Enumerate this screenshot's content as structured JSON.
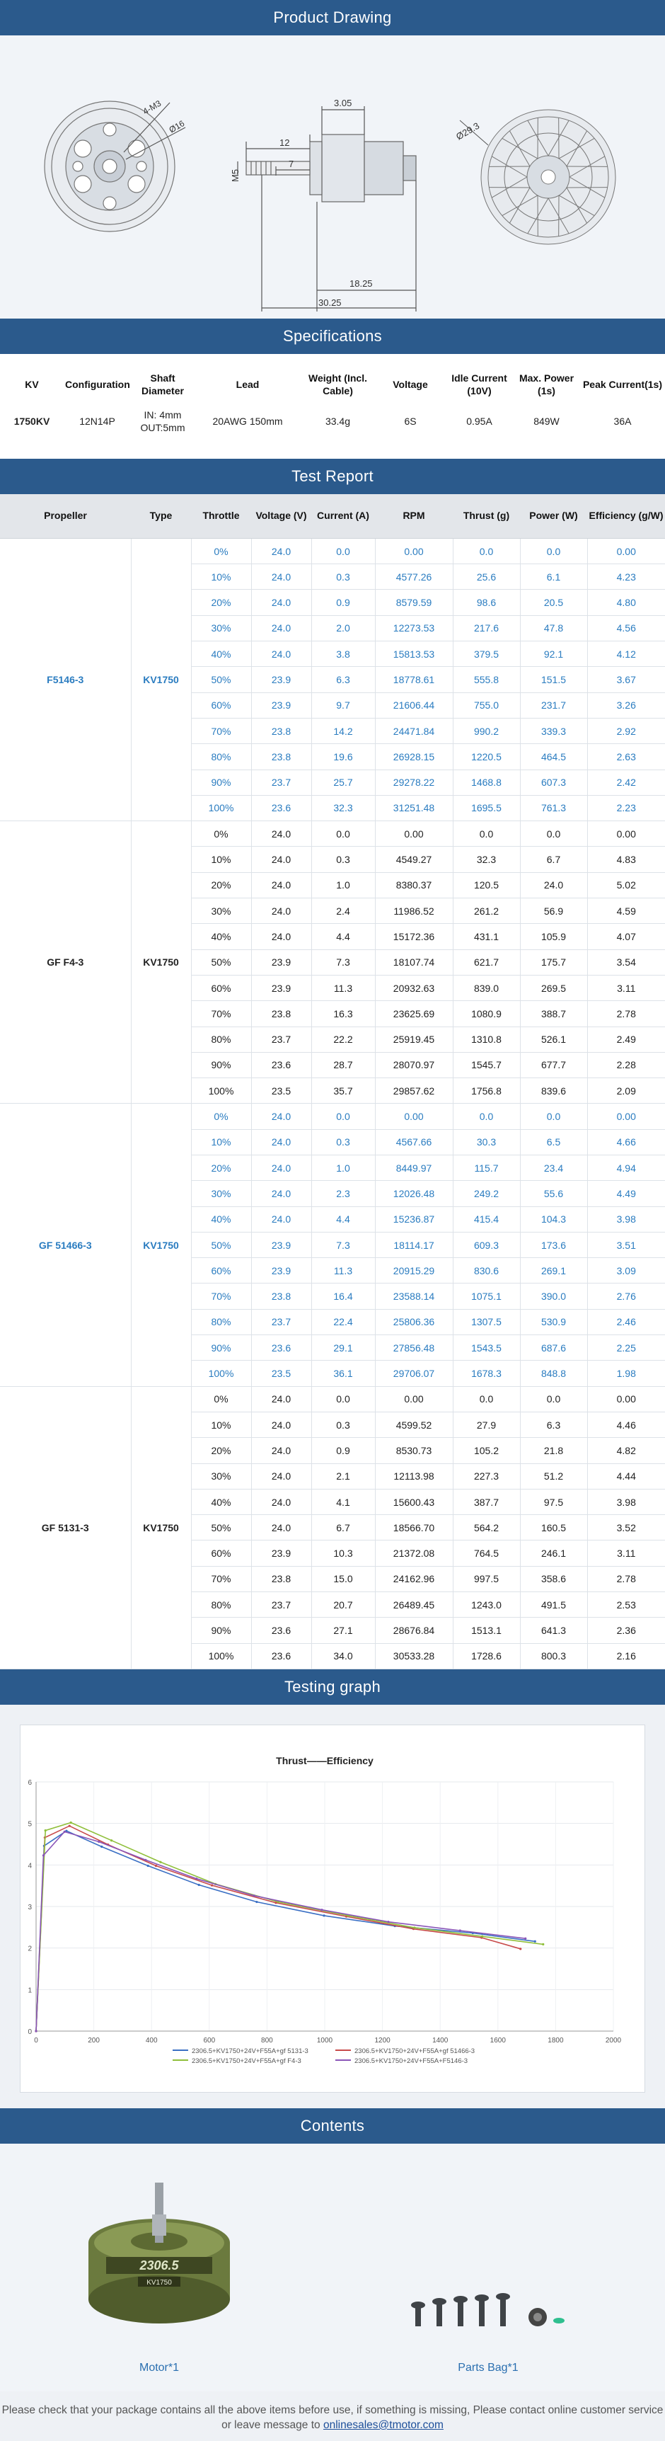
{
  "sections": {
    "drawing": "Product Drawing",
    "specs": "Specifications",
    "test": "Test Report",
    "graph": "Testing graph",
    "contents": "Contents"
  },
  "drawing_dims": {
    "d1": "4-M3",
    "d2": "Ø16",
    "d3": "3.05",
    "d4": "12",
    "d5": "7",
    "d6": "M5",
    "d7": "18.25",
    "d8": "30.25",
    "d9": "Ø29.3"
  },
  "specs": {
    "headers": [
      "KV",
      "Configuration",
      "Shaft Diameter",
      "Lead",
      "Weight (Incl. Cable)",
      "Voltage",
      "Idle Current (10V)",
      "Max. Power (1s)",
      "Peak Current(1s)"
    ],
    "row": [
      "1750KV",
      "12N14P",
      "IN: 4mm\nOUT:5mm",
      "20AWG 150mm",
      "33.4g",
      "6S",
      "0.95A",
      "849W",
      "36A"
    ]
  },
  "test": {
    "headers": [
      "Propeller",
      "Type",
      "Throttle",
      "Voltage (V)",
      "Current (A)",
      "RPM",
      "Thrust (g)",
      "Power (W)",
      "Efficiency (g/W)"
    ],
    "groups": [
      {
        "propeller": "F5146-3",
        "type": "KV1750",
        "style": "blue",
        "rows": [
          [
            "0%",
            "24.0",
            "0.0",
            "0.00",
            "0.0",
            "0.0",
            "0.00"
          ],
          [
            "10%",
            "24.0",
            "0.3",
            "4577.26",
            "25.6",
            "6.1",
            "4.23"
          ],
          [
            "20%",
            "24.0",
            "0.9",
            "8579.59",
            "98.6",
            "20.5",
            "4.80"
          ],
          [
            "30%",
            "24.0",
            "2.0",
            "12273.53",
            "217.6",
            "47.8",
            "4.56"
          ],
          [
            "40%",
            "24.0",
            "3.8",
            "15813.53",
            "379.5",
            "92.1",
            "4.12"
          ],
          [
            "50%",
            "23.9",
            "6.3",
            "18778.61",
            "555.8",
            "151.5",
            "3.67"
          ],
          [
            "60%",
            "23.9",
            "9.7",
            "21606.44",
            "755.0",
            "231.7",
            "3.26"
          ],
          [
            "70%",
            "23.8",
            "14.2",
            "24471.84",
            "990.2",
            "339.3",
            "2.92"
          ],
          [
            "80%",
            "23.8",
            "19.6",
            "26928.15",
            "1220.5",
            "464.5",
            "2.63"
          ],
          [
            "90%",
            "23.7",
            "25.7",
            "29278.22",
            "1468.8",
            "607.3",
            "2.42"
          ],
          [
            "100%",
            "23.6",
            "32.3",
            "31251.48",
            "1695.5",
            "761.3",
            "2.23"
          ]
        ]
      },
      {
        "propeller": "GF F4-3",
        "type": "KV1750",
        "style": "black",
        "rows": [
          [
            "0%",
            "24.0",
            "0.0",
            "0.00",
            "0.0",
            "0.0",
            "0.00"
          ],
          [
            "10%",
            "24.0",
            "0.3",
            "4549.27",
            "32.3",
            "6.7",
            "4.83"
          ],
          [
            "20%",
            "24.0",
            "1.0",
            "8380.37",
            "120.5",
            "24.0",
            "5.02"
          ],
          [
            "30%",
            "24.0",
            "2.4",
            "11986.52",
            "261.2",
            "56.9",
            "4.59"
          ],
          [
            "40%",
            "24.0",
            "4.4",
            "15172.36",
            "431.1",
            "105.9",
            "4.07"
          ],
          [
            "50%",
            "23.9",
            "7.3",
            "18107.74",
            "621.7",
            "175.7",
            "3.54"
          ],
          [
            "60%",
            "23.9",
            "11.3",
            "20932.63",
            "839.0",
            "269.5",
            "3.11"
          ],
          [
            "70%",
            "23.8",
            "16.3",
            "23625.69",
            "1080.9",
            "388.7",
            "2.78"
          ],
          [
            "80%",
            "23.7",
            "22.2",
            "25919.45",
            "1310.8",
            "526.1",
            "2.49"
          ],
          [
            "90%",
            "23.6",
            "28.7",
            "28070.97",
            "1545.7",
            "677.7",
            "2.28"
          ],
          [
            "100%",
            "23.5",
            "35.7",
            "29857.62",
            "1756.8",
            "839.6",
            "2.09"
          ]
        ]
      },
      {
        "propeller": "GF 51466-3",
        "type": "KV1750",
        "style": "blue",
        "rows": [
          [
            "0%",
            "24.0",
            "0.0",
            "0.00",
            "0.0",
            "0.0",
            "0.00"
          ],
          [
            "10%",
            "24.0",
            "0.3",
            "4567.66",
            "30.3",
            "6.5",
            "4.66"
          ],
          [
            "20%",
            "24.0",
            "1.0",
            "8449.97",
            "115.7",
            "23.4",
            "4.94"
          ],
          [
            "30%",
            "24.0",
            "2.3",
            "12026.48",
            "249.2",
            "55.6",
            "4.49"
          ],
          [
            "40%",
            "24.0",
            "4.4",
            "15236.87",
            "415.4",
            "104.3",
            "3.98"
          ],
          [
            "50%",
            "23.9",
            "7.3",
            "18114.17",
            "609.3",
            "173.6",
            "3.51"
          ],
          [
            "60%",
            "23.9",
            "11.3",
            "20915.29",
            "830.6",
            "269.1",
            "3.09"
          ],
          [
            "70%",
            "23.8",
            "16.4",
            "23588.14",
            "1075.1",
            "390.0",
            "2.76"
          ],
          [
            "80%",
            "23.7",
            "22.4",
            "25806.36",
            "1307.5",
            "530.9",
            "2.46"
          ],
          [
            "90%",
            "23.6",
            "29.1",
            "27856.48",
            "1543.5",
            "687.6",
            "2.25"
          ],
          [
            "100%",
            "23.5",
            "36.1",
            "29706.07",
            "1678.3",
            "848.8",
            "1.98"
          ]
        ]
      },
      {
        "propeller": "GF 5131-3",
        "type": "KV1750",
        "style": "black",
        "rows": [
          [
            "0%",
            "24.0",
            "0.0",
            "0.00",
            "0.0",
            "0.0",
            "0.00"
          ],
          [
            "10%",
            "24.0",
            "0.3",
            "4599.52",
            "27.9",
            "6.3",
            "4.46"
          ],
          [
            "20%",
            "24.0",
            "0.9",
            "8530.73",
            "105.2",
            "21.8",
            "4.82"
          ],
          [
            "30%",
            "24.0",
            "2.1",
            "12113.98",
            "227.3",
            "51.2",
            "4.44"
          ],
          [
            "40%",
            "24.0",
            "4.1",
            "15600.43",
            "387.7",
            "97.5",
            "3.98"
          ],
          [
            "50%",
            "24.0",
            "6.7",
            "18566.70",
            "564.2",
            "160.5",
            "3.52"
          ],
          [
            "60%",
            "23.9",
            "10.3",
            "21372.08",
            "764.5",
            "246.1",
            "3.11"
          ],
          [
            "70%",
            "23.8",
            "15.0",
            "24162.96",
            "997.5",
            "358.6",
            "2.78"
          ],
          [
            "80%",
            "23.7",
            "20.7",
            "26489.45",
            "1243.0",
            "491.5",
            "2.53"
          ],
          [
            "90%",
            "23.6",
            "27.1",
            "28676.84",
            "1513.1",
            "641.3",
            "2.36"
          ],
          [
            "100%",
            "23.6",
            "34.0",
            "30533.28",
            "1728.6",
            "800.3",
            "2.16"
          ]
        ]
      }
    ]
  },
  "chart_data": {
    "type": "line",
    "title": "Thrust——Efficiency",
    "xlabel": "",
    "ylabel": "",
    "xlim": [
      0,
      2000
    ],
    "ylim": [
      0,
      6
    ],
    "xticks": [
      0,
      200,
      400,
      600,
      800,
      1000,
      1200,
      1400,
      1600,
      1800,
      2000
    ],
    "yticks": [
      0,
      1,
      2,
      3,
      4,
      5,
      6
    ],
    "legend_position": "bottom",
    "series": [
      {
        "name": "2306.5+KV1750+24V+F55A+gf 5131-3",
        "color": "#3a6fc4",
        "x": [
          0,
          27.9,
          105.2,
          227.3,
          387.7,
          564.2,
          764.5,
          997.5,
          1243.0,
          1513.1,
          1728.6
        ],
        "y": [
          0,
          4.46,
          4.82,
          4.44,
          3.98,
          3.52,
          3.11,
          2.78,
          2.53,
          2.36,
          2.16
        ]
      },
      {
        "name": "2306.5+KV1750+24V+F55A+gf 51466-3",
        "color": "#c84a4a",
        "x": [
          0,
          30.3,
          115.7,
          249.2,
          415.4,
          609.3,
          830.6,
          1075.1,
          1307.5,
          1543.5,
          1678.3
        ],
        "y": [
          0,
          4.66,
          4.94,
          4.49,
          3.98,
          3.51,
          3.09,
          2.76,
          2.46,
          2.25,
          1.98
        ]
      },
      {
        "name": "2306.5+KV1750+24V+F55A+gf F4-3",
        "color": "#8fbf3a",
        "x": [
          0,
          32.3,
          120.5,
          261.2,
          431.1,
          621.7,
          839.0,
          1080.9,
          1310.8,
          1545.7,
          1756.8
        ],
        "y": [
          0,
          4.83,
          5.02,
          4.59,
          4.07,
          3.54,
          3.11,
          2.78,
          2.49,
          2.28,
          2.09
        ]
      },
      {
        "name": "2306.5+KV1750+24V+F55A+F5146-3",
        "color": "#8a55b8",
        "x": [
          0,
          25.6,
          98.6,
          217.6,
          379.5,
          555.8,
          755.0,
          990.2,
          1220.5,
          1468.8,
          1695.5
        ],
        "y": [
          0,
          4.23,
          4.8,
          4.56,
          4.12,
          3.67,
          3.26,
          2.92,
          2.63,
          2.42,
          2.23
        ]
      }
    ]
  },
  "contents": {
    "motor_label": "2306.5",
    "motor_sub": "KV1750",
    "item1": "Motor*1",
    "item2": "Parts Bag*1"
  },
  "footer": {
    "text": "Please check that your package contains all the above items before use, if something is missing, Please contact online customer service or leave message to",
    "email": "onlinesales@tmotor.com"
  },
  "colors": {
    "banner": "#2b5a8c",
    "blue_text": "#2a7cc0"
  }
}
